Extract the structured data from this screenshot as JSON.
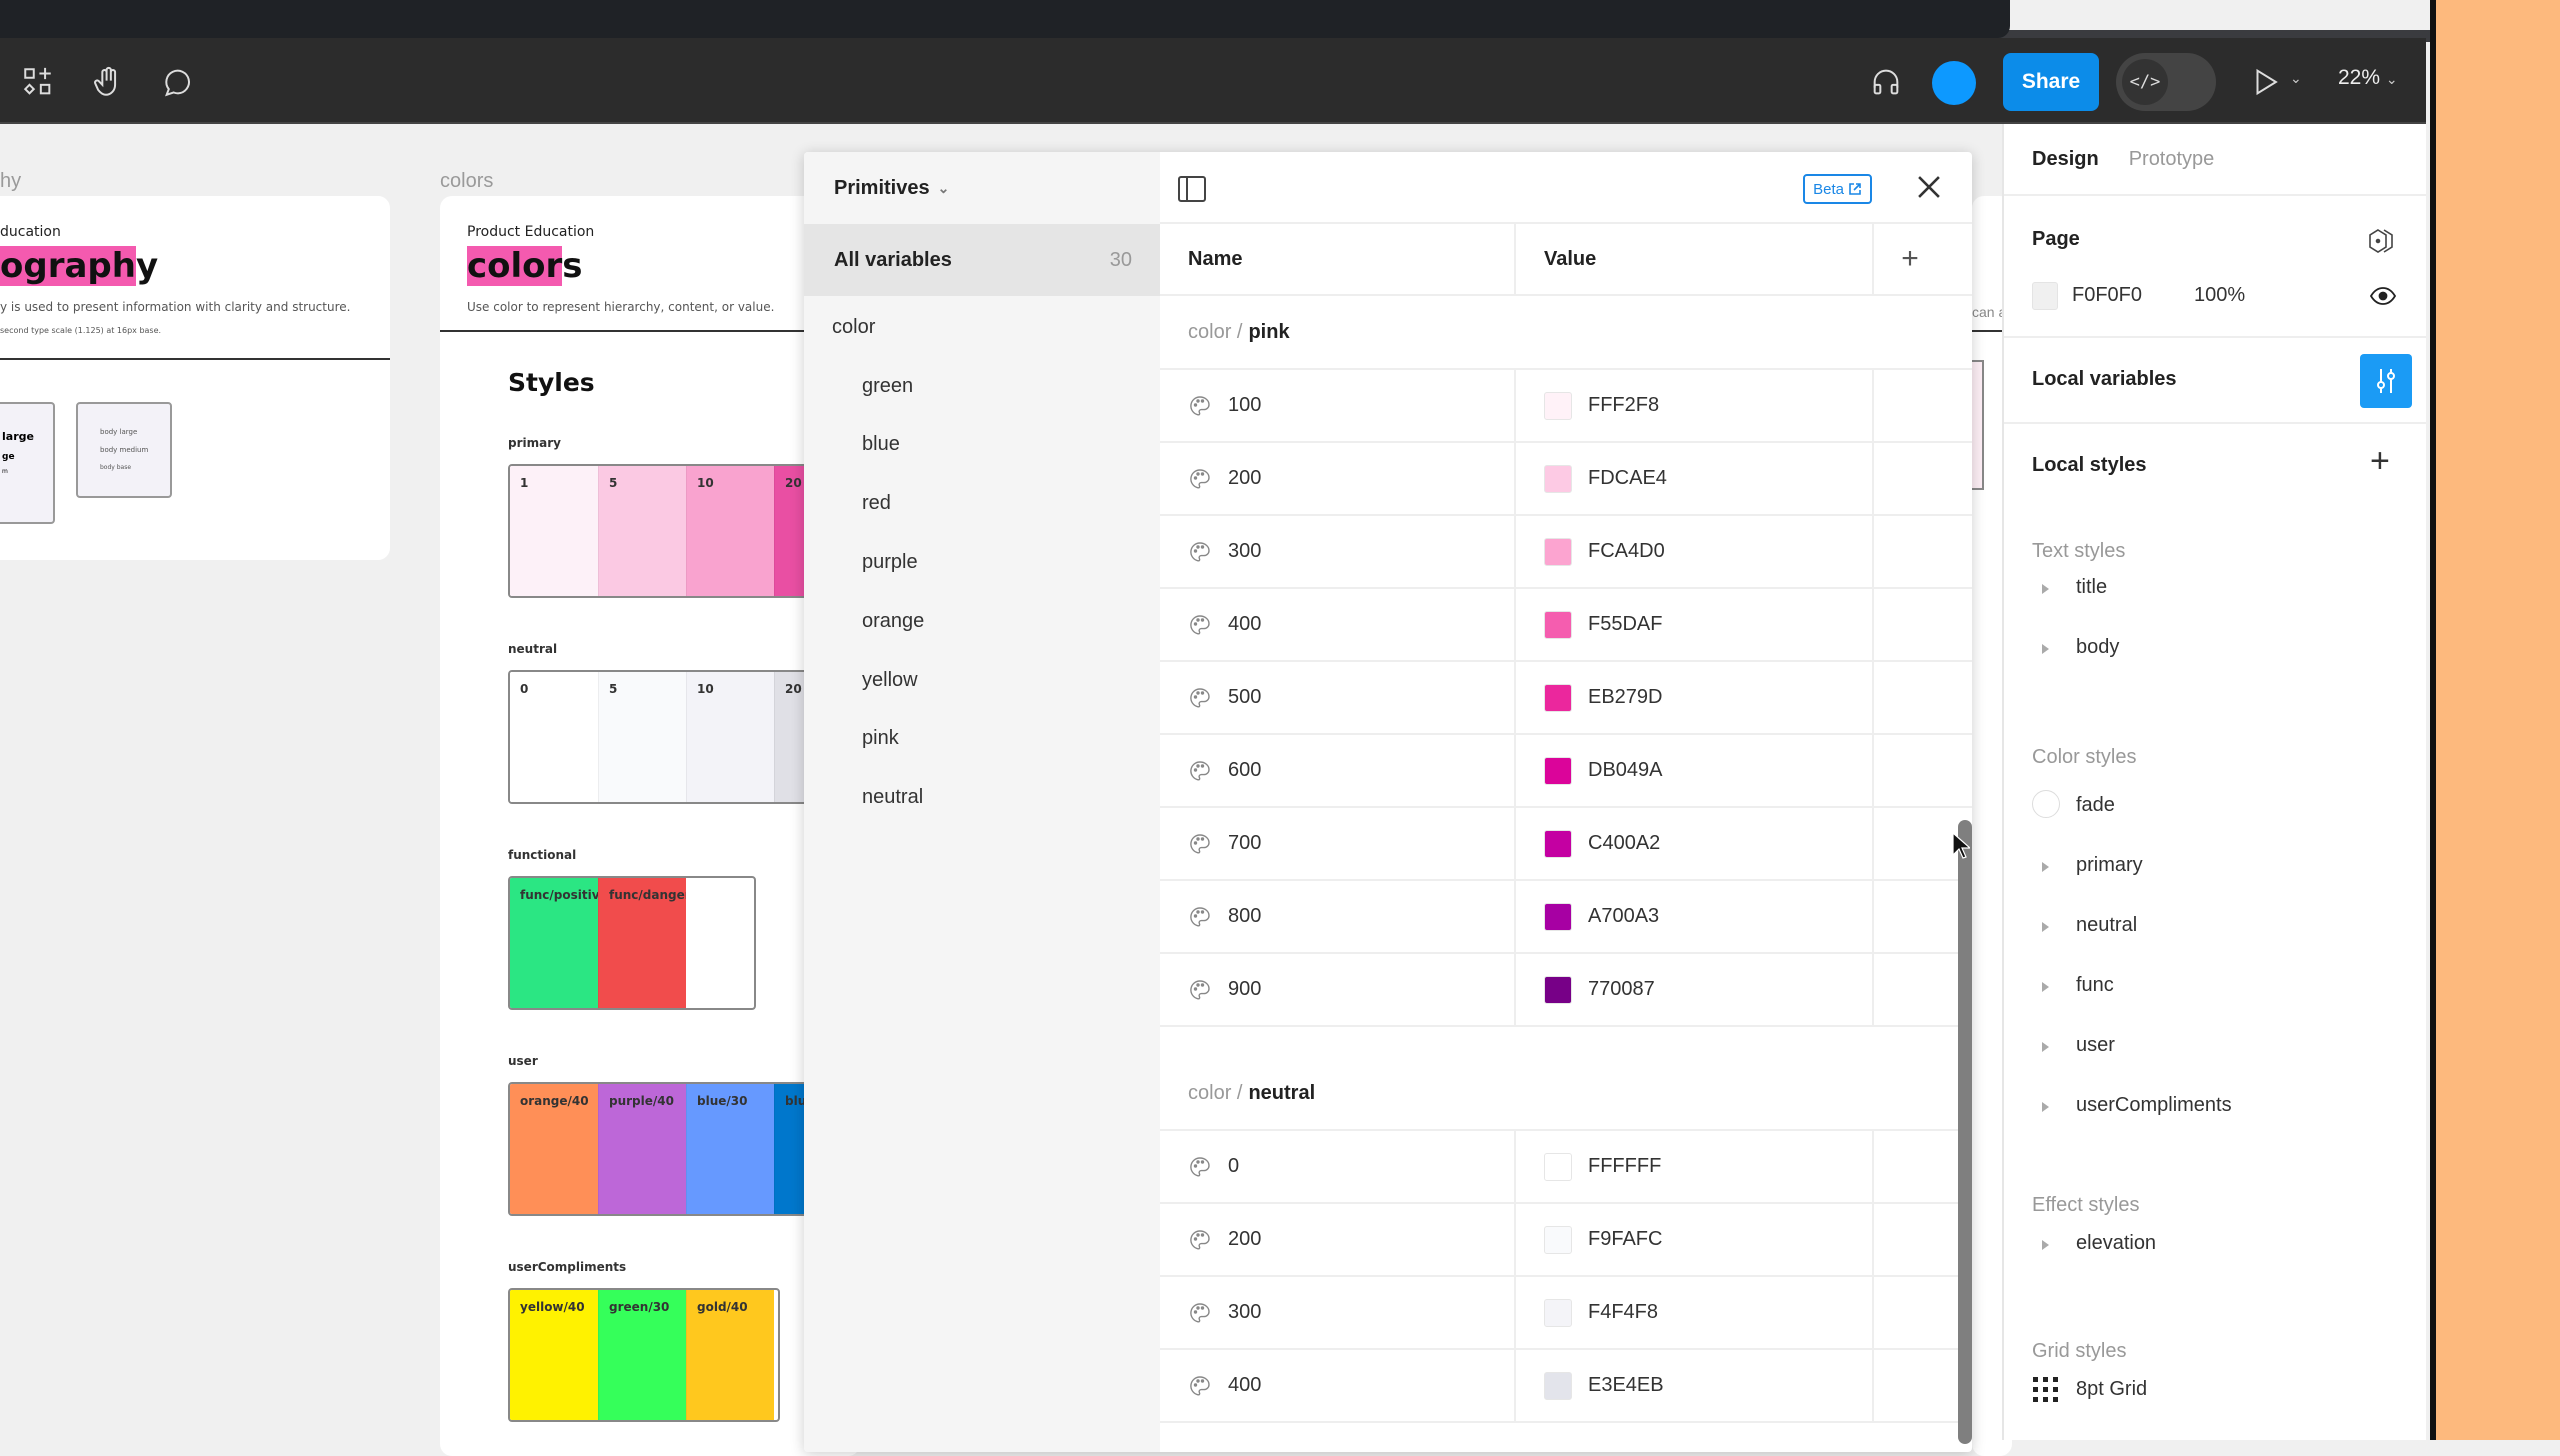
{
  "toolbar": {
    "left_icons": [
      "assets-icon",
      "hand-tool-icon",
      "comment-icon"
    ],
    "share_label": "Share",
    "dev_mode_glyph": "</>",
    "zoom_level": "22%",
    "colors": {
      "share": "#0c8ce9",
      "avatar": "#0d99ff"
    }
  },
  "canvas": {
    "background": "#F0F0F0",
    "frames": [
      {
        "label": "hy",
        "eyebrow": "ducation",
        "title_highlight": "ograph",
        "title_rest": "y",
        "description": "y is used to present information with clarity and structure.",
        "note": "second type scale (1.125) at 16px base.",
        "cards": [
          {
            "lines": [
              "large",
              "ge",
              "m"
            ]
          },
          {
            "lines": [
              "body large",
              "body medium",
              "body base"
            ]
          }
        ]
      },
      {
        "label": "colors",
        "eyebrow": "Product Education",
        "title_highlight": "color",
        "title_rest": "s",
        "description": "Use color to represent hierarchy, content, or value.",
        "styles_heading": "Styles",
        "groups": [
          {
            "name": "primary",
            "swatches": [
              {
                "label": "1",
                "color": "#FDF1F8"
              },
              {
                "label": "5",
                "color": "#FBC9E3"
              },
              {
                "label": "10",
                "color": "#F9A3CF"
              },
              {
                "label": "20",
                "color": "#E94FA3"
              }
            ]
          },
          {
            "name": "neutral",
            "swatches": [
              {
                "label": "0",
                "color": "#FFFFFF"
              },
              {
                "label": "5",
                "color": "#F9FAFC"
              },
              {
                "label": "10",
                "color": "#F3F3F8"
              },
              {
                "label": "20",
                "color": "#E0E0E6"
              }
            ]
          },
          {
            "name": "functional",
            "swatches": [
              {
                "label": "func/positive",
                "color": "#2BE683"
              },
              {
                "label": "func/danger",
                "color": "#F14C4C"
              }
            ]
          },
          {
            "name": "user",
            "swatches": [
              {
                "label": "orange/40",
                "color": "#FF8F57"
              },
              {
                "label": "purple/40",
                "color": "#BD67D8"
              },
              {
                "label": "blue/30",
                "color": "#6699FF"
              },
              {
                "label": "blu",
                "color": "#0077CC"
              }
            ]
          },
          {
            "name": "userCompliments",
            "swatches": [
              {
                "label": "yellow/40",
                "color": "#FFF200"
              },
              {
                "label": "green/30",
                "color": "#35FF5A"
              },
              {
                "label": "gold/40",
                "color": "#FFC81E"
              }
            ]
          }
        ]
      }
    ],
    "partial_text": "can a"
  },
  "variables_panel": {
    "collection": "Primitives",
    "all_variables_label": "All variables",
    "all_variables_count": "30",
    "root_group": "color",
    "groups": [
      "green",
      "blue",
      "red",
      "purple",
      "orange",
      "yellow",
      "pink",
      "neutral"
    ],
    "beta_label": "Beta",
    "columns": {
      "name": "Name",
      "value": "Value"
    },
    "sections": [
      {
        "prefix": "color /",
        "name": "pink",
        "rows": [
          {
            "name": "100",
            "value": "FFF2F8"
          },
          {
            "name": "200",
            "value": "FDCAE4"
          },
          {
            "name": "300",
            "value": "FCA4D0"
          },
          {
            "name": "400",
            "value": "F55DAF"
          },
          {
            "name": "500",
            "value": "EB279D"
          },
          {
            "name": "600",
            "value": "DB049A"
          },
          {
            "name": "700",
            "value": "C400A2"
          },
          {
            "name": "800",
            "value": "A700A3"
          },
          {
            "name": "900",
            "value": "770087"
          }
        ]
      },
      {
        "prefix": "color /",
        "name": "neutral",
        "rows": [
          {
            "name": "0",
            "value": "FFFFFF"
          },
          {
            "name": "200",
            "value": "F9FAFC"
          },
          {
            "name": "300",
            "value": "F4F4F8"
          },
          {
            "name": "400",
            "value": "E3E4EB"
          }
        ]
      }
    ]
  },
  "right_panel": {
    "tabs": [
      "Design",
      "Prototype"
    ],
    "page": {
      "title": "Page",
      "color": "F0F0F0",
      "opacity": "100%"
    },
    "local_variables": "Local variables",
    "local_styles": "Local styles",
    "text_styles": {
      "title": "Text styles",
      "items": [
        "title",
        "body"
      ]
    },
    "color_styles": {
      "title": "Color styles",
      "items": [
        "fade",
        "primary",
        "neutral",
        "func",
        "user",
        "userCompliments"
      ]
    },
    "effect_styles": {
      "title": "Effect styles",
      "items": [
        "elevation"
      ]
    },
    "grid_styles": {
      "title": "Grid styles",
      "items": [
        "8pt Grid"
      ]
    }
  }
}
